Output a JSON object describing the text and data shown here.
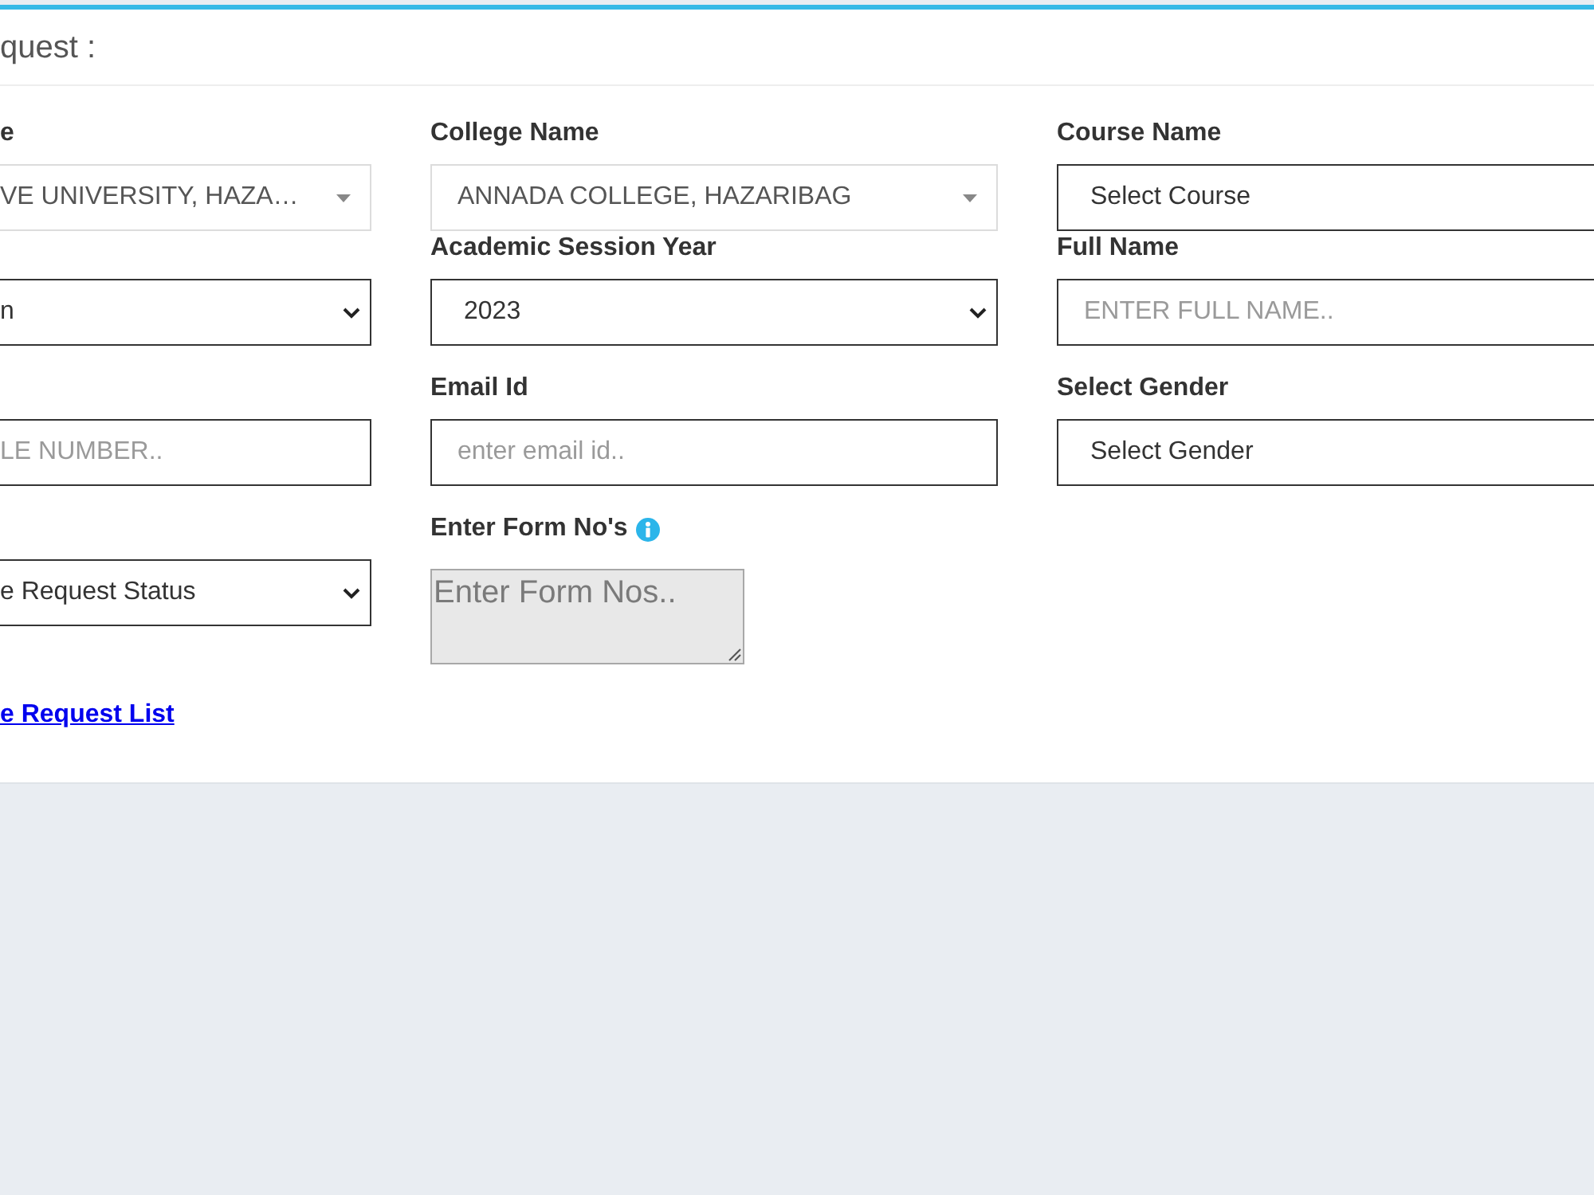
{
  "card": {
    "title": "quest :"
  },
  "rows": [
    [
      {
        "kind": "select2",
        "label": "e",
        "value": "VE UNIVERSITY, HAZA…"
      },
      {
        "kind": "select2",
        "label": "College Name",
        "value": "ANNADA COLLEGE, HAZARIBAG"
      },
      {
        "kind": "select",
        "label": "Course Name",
        "value": "Select Course"
      }
    ],
    [
      {
        "kind": "select",
        "value": "n"
      },
      {
        "kind": "select",
        "label": "Academic Session Year",
        "value": "2023"
      },
      {
        "kind": "input",
        "label": "Full Name",
        "placeholder": "ENTER FULL NAME.."
      }
    ],
    [
      {
        "kind": "input",
        "placeholder": "LE NUMBER.."
      },
      {
        "kind": "input",
        "label": "Email Id",
        "placeholder": "enter email id.."
      },
      {
        "kind": "select",
        "label": "Select Gender",
        "value": "Select Gender"
      }
    ],
    [
      {
        "kind": "select",
        "value": "e Request Status"
      },
      {
        "kind": "textarea",
        "label": "Enter Form No's",
        "info": true,
        "placeholder": "Enter Form Nos.."
      }
    ]
  ],
  "link": {
    "text": "e Request List"
  }
}
